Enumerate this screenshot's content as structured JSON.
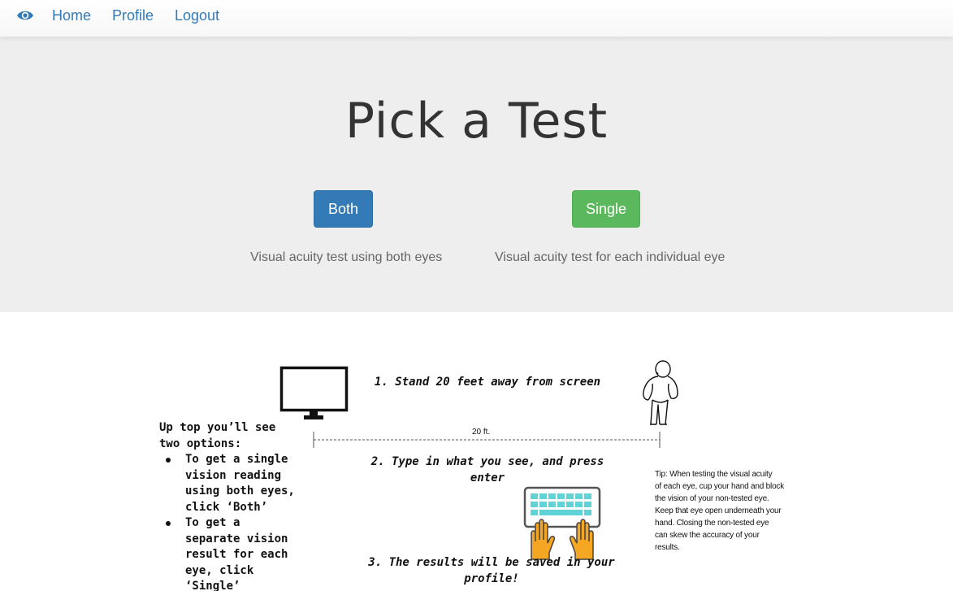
{
  "nav": {
    "brand_icon": "eye-icon",
    "links": [
      {
        "label": "Home"
      },
      {
        "label": "Profile"
      },
      {
        "label": "Logout"
      }
    ]
  },
  "hero": {
    "title": "Pick a Test",
    "options": [
      {
        "button_label": "Both",
        "description": "Visual acuity test using both eyes",
        "color": "#337ab7"
      },
      {
        "button_label": "Single",
        "description": "Visual acuity test for each individual eye",
        "color": "#5cb85c"
      }
    ]
  },
  "instructions": {
    "intro_lines": [
      "Up top you’ll see",
      "two options:"
    ],
    "bullets": [
      [
        "To get a single",
        "vision reading",
        "using both eyes,",
        "click ‘Both’"
      ],
      [
        "To get a",
        "separate vision",
        "result for each",
        "eye, click",
        "‘Single’"
      ]
    ],
    "steps": [
      {
        "lines": [
          "1.  Stand 20 feet away from screen"
        ]
      },
      {
        "lines": [
          "2.  Type in what you see, and press",
          "enter"
        ]
      },
      {
        "lines": [
          "3.  The results will be saved in your",
          "profile!"
        ]
      }
    ],
    "distance_label": "20 ft.",
    "tip_lines": [
      "Tip: When testing the visual acuity",
      "of each eye, cup your hand and block",
      "the vision of your non-tested eye.",
      "Keep that eye open underneath your",
      "hand. Closing the non-tested eye",
      "can skew the accuracy of your",
      "results."
    ],
    "icons": [
      "monitor-icon",
      "person-icon",
      "keyboard-hands-icon"
    ]
  }
}
